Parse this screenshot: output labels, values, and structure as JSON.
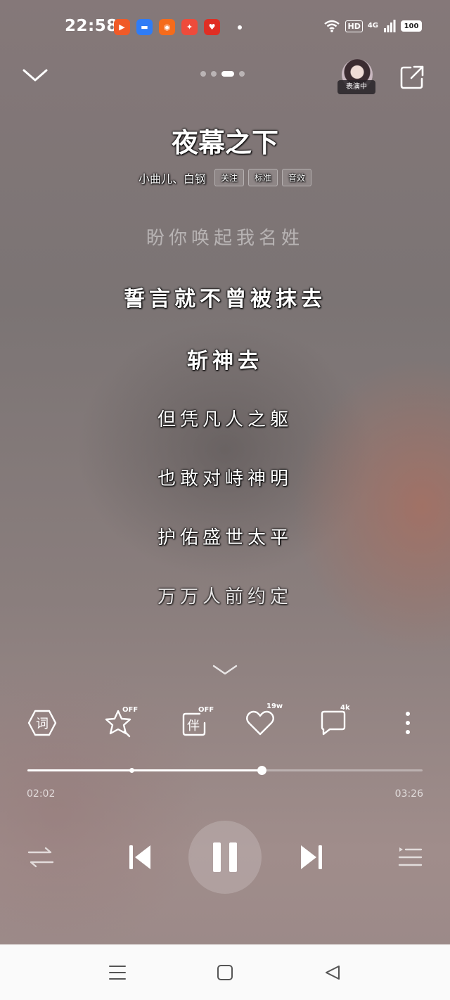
{
  "status_bar": {
    "time": "22:58",
    "hd": "HD",
    "network": "4G",
    "battery": "100",
    "app_icons": [
      {
        "name": "kuaishou-icon",
        "color": "#f05a28"
      },
      {
        "name": "message-icon",
        "color": "#2f7cf6"
      },
      {
        "name": "taobao-icon",
        "color": "#f56b1b"
      },
      {
        "name": "game-icon",
        "color": "#ee4b3b"
      },
      {
        "name": "pinduoduo-icon",
        "color": "#e02e24"
      }
    ]
  },
  "header": {
    "avatar_label": "表演中",
    "page_indicator": {
      "total": 4,
      "active": 2
    }
  },
  "song": {
    "title": "夜幕之下",
    "artist": "小曲儿、白钢",
    "tags": [
      "关注",
      "标准",
      "音效"
    ]
  },
  "lyrics": [
    {
      "text": "盼你唤起我名姓",
      "state": "past"
    },
    {
      "text": "誓言就不曾被抹去",
      "state": "current"
    },
    {
      "text": "斩神去",
      "state": "next"
    },
    {
      "text": "但凭凡人之躯",
      "state": "next"
    },
    {
      "text": "也敢对峙神明",
      "state": "next"
    },
    {
      "text": "护佑盛世太平",
      "state": "next"
    },
    {
      "text": "万万人前约定",
      "state": "next"
    }
  ],
  "actions": {
    "lyrics_label": "词",
    "effects_badge": "OFF",
    "companion_label": "伴",
    "companion_badge": "OFF",
    "likes_badge": "19w",
    "comments_badge": "4k"
  },
  "progress": {
    "elapsed": "02:02",
    "duration": "03:26",
    "played_fraction": 0.592,
    "buffered_marker": 0.263
  },
  "colors": {
    "accent": "#ffffff",
    "navbar_bg": "#fafafa"
  }
}
